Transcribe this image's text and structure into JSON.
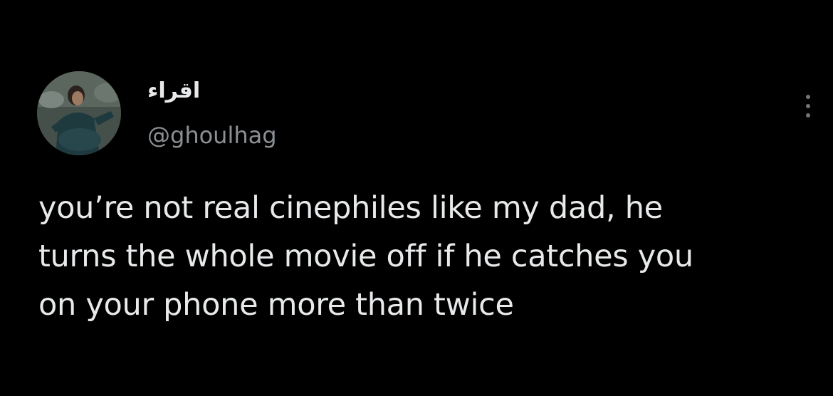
{
  "tweet": {
    "author": {
      "display_name": "اقراء",
      "handle": "@ghoulhag",
      "avatar_icon": "profile-photo"
    },
    "more_icon": "ellipsis-vertical-icon",
    "text_lines": [
      "you’re not real cinephiles like my dad, he",
      "turns the whole movie off if he catches you",
      "on your phone more than twice"
    ]
  },
  "colors": {
    "background": "#000000",
    "text_primary": "#e7e9ea",
    "text_secondary": "#8b9095"
  }
}
